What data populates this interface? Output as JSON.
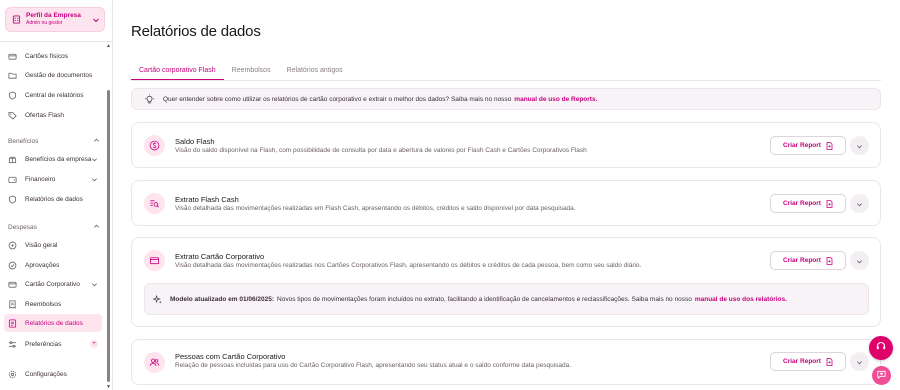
{
  "colors": {
    "accent": "#c6007e",
    "accent_bg": "#fde4ef",
    "fab": "#e0006a"
  },
  "sidebar": {
    "profile": {
      "name": "Perfil da Empresa",
      "role": "Admin ou gestor",
      "icon": "building-icon"
    },
    "items_top": [
      {
        "label": "Cartões físicos",
        "icon": "card-icon"
      },
      {
        "label": "Gestão de documentos",
        "icon": "folder-icon"
      },
      {
        "label": "Central de relatórios",
        "icon": "shield-icon"
      },
      {
        "label": "Ofertas Flash",
        "icon": "tag-icon"
      }
    ],
    "section_beneficios": "Benefícios",
    "items_beneficios": [
      {
        "label": "Benefícios da empresa",
        "icon": "gift-icon"
      },
      {
        "label": "Financeiro",
        "icon": "wallet-icon"
      },
      {
        "label": "Relatórios de dados",
        "icon": "report-icon"
      }
    ],
    "section_despesas": "Despesas",
    "items_despesas": [
      {
        "label": "Visão geral",
        "icon": "eye-icon"
      },
      {
        "label": "Aprovações",
        "icon": "check-icon"
      },
      {
        "label": "Cartão Corporativo",
        "icon": "card-icon"
      },
      {
        "label": "Reembolsos",
        "icon": "receipt-icon"
      },
      {
        "label": "Relatórios de dados",
        "icon": "report-icon"
      },
      {
        "label": "Preferências",
        "icon": "sliders-icon",
        "badge": "+"
      }
    ],
    "settings": {
      "label": "Configurações",
      "icon": "gear-icon"
    }
  },
  "main": {
    "title": "Relatórios de dados",
    "tabs": [
      {
        "label": "Cartão corporativo Flash",
        "active": true
      },
      {
        "label": "Reembolsos",
        "active": false
      },
      {
        "label": "Relatórios antigos",
        "active": false
      }
    ],
    "banner": {
      "text": "Quer entender sobre como utilizar os relatórios de cartão corporativo e extrair o melhor dos dados? Saiba mais no nosso",
      "link": "manual de uso de Reports."
    },
    "create_label": "Criar Report",
    "cards": [
      {
        "title": "Saldo Flash",
        "desc": "Visão do saldo disponível na Flash, com possibilidade de consulta por data e abertura de valores por Flash Cash e Cartões Corporativos Flash",
        "icon": "dollar-icon"
      },
      {
        "title": "Extrato Flash Cash",
        "desc": "Visão detalhada das movimentações realizadas em Flash Cash, apresentando os débitos, créditos e saldo disponível por data pesquisada.",
        "icon": "search-list-icon"
      },
      {
        "title": "Extrato Cartão Corporativo",
        "desc": "Visão detalhada das movimentações realizadas nos Cartões Corporativos Flash, apresentando os débitos e créditos de cada pessoa, bem como seu saldo diário.",
        "icon": "card-icon"
      },
      {
        "title": "Pessoas com Cartão Corporativo",
        "desc": "Relação de pessoas incluídas para uso do Cartão Corporativo Flash, apresentando seu status atual e o saldo conforme data pesquisada.",
        "icon": "users-icon"
      }
    ],
    "notice": {
      "bold": "Modelo atualizado em 01/06/2025:",
      "text": "Novos tipos de movimentações foram incluídos no extrato, facilitando a identificação de cancelamentos e reclassificações. Saiba mais no nosso",
      "link": "manual de uso dos relatórios."
    }
  }
}
